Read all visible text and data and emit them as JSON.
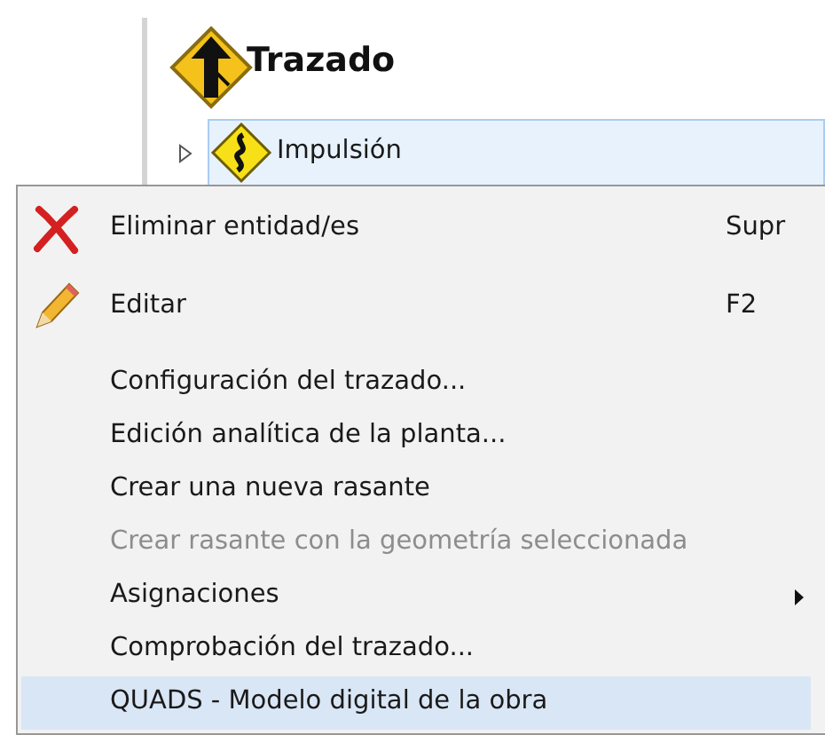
{
  "tree": {
    "title": "Trazado",
    "items": [
      {
        "label": "Impulsión",
        "expanded": false,
        "selected": true
      }
    ]
  },
  "context_menu": {
    "items": [
      {
        "kind": "delete",
        "label": "Eliminar entidad/es",
        "shortcut": "Supr",
        "disabled": false,
        "selected": false
      },
      {
        "kind": "edit",
        "label": "Editar",
        "shortcut": "F2",
        "disabled": false,
        "selected": false
      },
      {
        "kind": "separator"
      },
      {
        "kind": "plain",
        "label": "Configuración del trazado...",
        "disabled": false,
        "selected": false
      },
      {
        "kind": "plain",
        "label": "Edición analítica de la planta...",
        "disabled": false,
        "selected": false
      },
      {
        "kind": "plain",
        "label": "Crear una nueva rasante",
        "disabled": false,
        "selected": false
      },
      {
        "kind": "plain",
        "label": "Crear rasante con la geometría seleccionada",
        "disabled": true,
        "selected": false
      },
      {
        "kind": "submenu",
        "label": "Asignaciones",
        "disabled": false,
        "selected": false
      },
      {
        "kind": "plain",
        "label": "Comprobación del trazado...",
        "disabled": false,
        "selected": false
      },
      {
        "kind": "plain",
        "label": "QUADS - Modelo digital de la obra",
        "disabled": false,
        "selected": true
      }
    ]
  }
}
